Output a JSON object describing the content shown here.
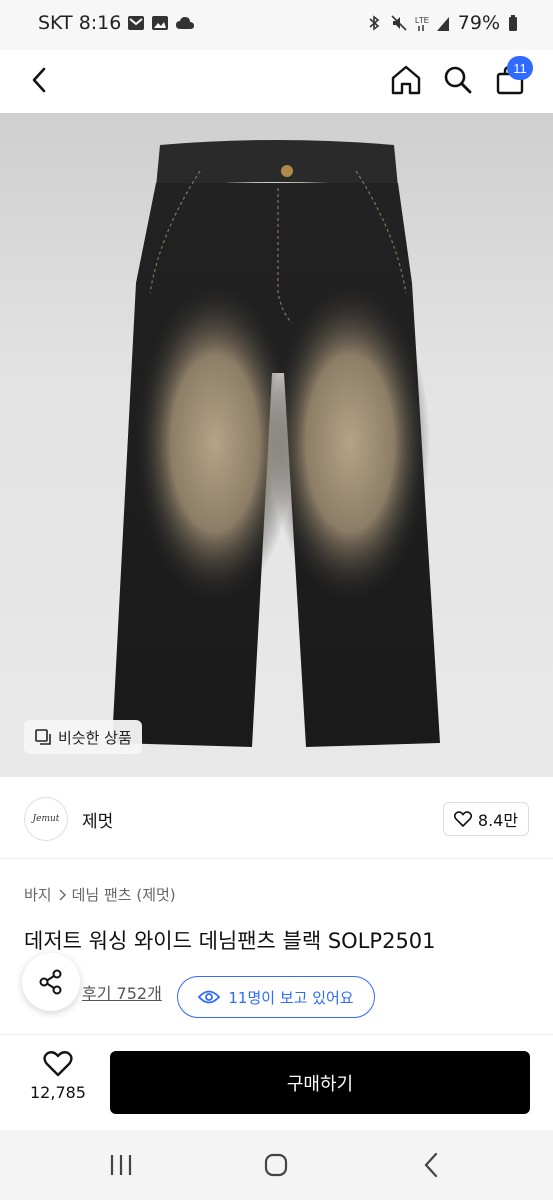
{
  "status_bar": {
    "carrier_time": "SKT 8:16",
    "battery": "79%",
    "icons": [
      "gmail-icon",
      "gallery-icon",
      "cloud-icon",
      "bluetooth-icon",
      "mute-icon",
      "lte-signal-icon",
      "battery-icon"
    ]
  },
  "header": {
    "back_icon": "chevron-left-icon",
    "home_icon": "home-icon",
    "search_icon": "search-icon",
    "cart_icon": "shopping-bag-icon",
    "cart_badge": "11",
    "accent": "#2f6bff"
  },
  "hero": {
    "similar_label": "비슷한 상품"
  },
  "brand": {
    "logo_text": "Jemut",
    "name": "제멋",
    "likes": "8.4만"
  },
  "breadcrumb": {
    "category": "바지",
    "subcategory": "데님 팬츠 (제멋)"
  },
  "product": {
    "title": "데저트 워싱 와이드 데님팬츠 블랙 SOLP2501",
    "review_link": "후기 752개",
    "viewers": "11명이 보고 있어요"
  },
  "bottom_bar": {
    "wish_count": "12,785",
    "buy_label": "구매하기"
  },
  "nav": {
    "icons": [
      "recent-apps-icon",
      "home-circle-icon",
      "back-nav-icon"
    ]
  }
}
